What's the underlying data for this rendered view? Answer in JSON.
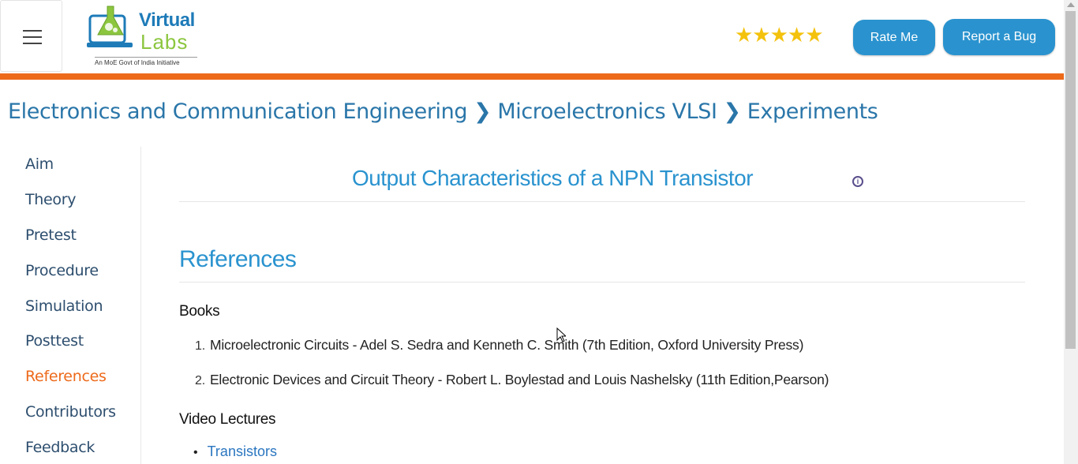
{
  "header": {
    "logo": {
      "line1": "Virtual",
      "line2": "Labs",
      "tagline": "An MoE Govt of India Initiative"
    },
    "rating_stars": "★★★★★",
    "rate_button": "Rate Me",
    "bug_button": "Report a Bug"
  },
  "breadcrumb": {
    "items": [
      "Electronics and Communication Engineering",
      "Microelectronics VLSI",
      "Experiments"
    ],
    "separator": "❯"
  },
  "sidebar": {
    "items": [
      {
        "label": "Aim"
      },
      {
        "label": "Theory"
      },
      {
        "label": "Pretest"
      },
      {
        "label": "Procedure"
      },
      {
        "label": "Simulation"
      },
      {
        "label": "Posttest"
      },
      {
        "label": "References",
        "active": true
      },
      {
        "label": "Contributors"
      },
      {
        "label": "Feedback"
      }
    ]
  },
  "main": {
    "experiment_title": "Output Characteristics of a NPN Transistor",
    "section_title": "References",
    "books_heading": "Books",
    "books": [
      {
        "num": "1.",
        "text": "Microelectronic Circuits - Adel S. Sedra and Kenneth C. Smith (7th Edition, Oxford University Press)"
      },
      {
        "num": "2.",
        "text": "Electronic Devices and Circuit Theory - Robert L. Boylestad and Louis Nashelsky (11th Edition,Pearson)"
      }
    ],
    "video_heading": "Video Lectures",
    "videos": [
      {
        "bullet": "•",
        "label": "Transistors"
      }
    ]
  },
  "colors": {
    "accent_blue": "#2a93cf",
    "accent_orange": "#ed6a1b",
    "star_yellow": "#f4c20d"
  }
}
